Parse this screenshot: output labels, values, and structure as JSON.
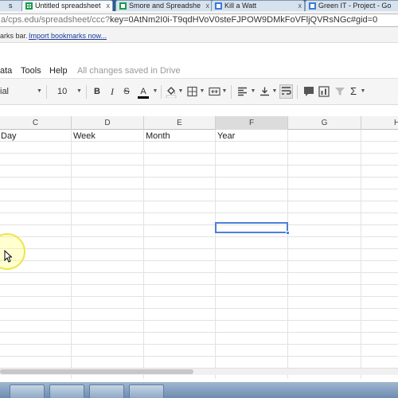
{
  "browser": {
    "tabs": [
      {
        "label": "s",
        "active": false,
        "icon": "page-icon"
      },
      {
        "label": "Untitled spreadsheet",
        "active": true,
        "icon": "spreadsheet-icon"
      },
      {
        "label": "Smore and Spreadshe",
        "active": false,
        "icon": "spreadsheet-icon"
      },
      {
        "label": "Kill a Watt",
        "active": false,
        "icon": "page-icon"
      },
      {
        "label": "Green IT - Project - Go",
        "active": false,
        "icon": "page-icon"
      }
    ],
    "url_prefix": "a/cps.edu/spreadsheet/ccc?",
    "url_rest": "key=0AtNm2I0i-T9qdHVoV0steFJPOW9DMkFoVFljQVRsNGc#gid=0",
    "bookmarks_text": "arks bar.",
    "bookmarks_link": "Import bookmarks now..."
  },
  "menu": {
    "items": [
      "ata",
      "Tools",
      "Help"
    ],
    "status": "All changes saved in Drive"
  },
  "toolbar": {
    "font_name": "ial",
    "font_size": "10",
    "bold": "B",
    "italic": "I",
    "strike": "S",
    "text_color": "A",
    "sigma": "Σ",
    "text_color_swatch": "#000000"
  },
  "sheet": {
    "columns": [
      "C",
      "D",
      "E",
      "F",
      "G",
      "H"
    ],
    "selected_column": "F",
    "header_row": [
      "Day",
      "Week",
      "Month",
      "Year",
      "",
      ""
    ]
  },
  "colors": {
    "selection": "#4d7fd8",
    "tab_strip": "#2a5c8f"
  }
}
